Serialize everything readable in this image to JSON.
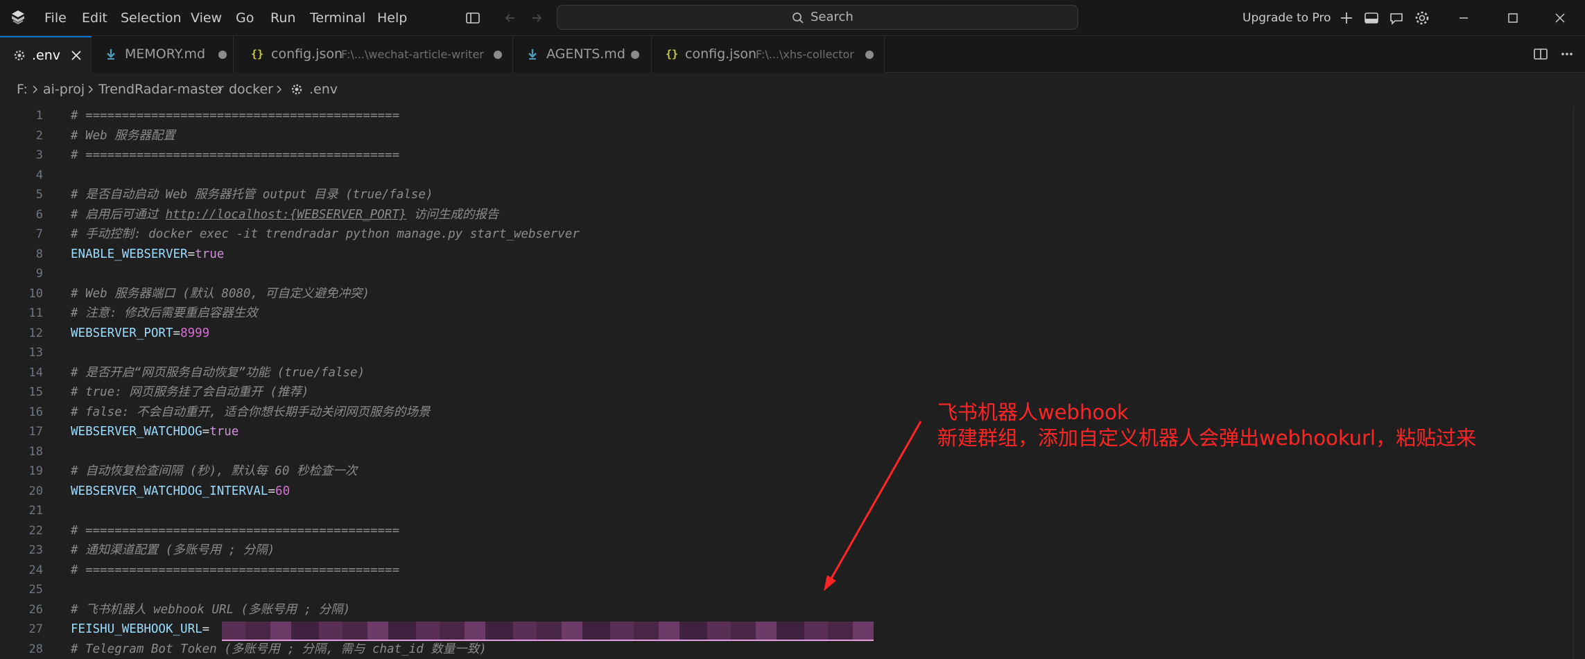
{
  "menu": [
    "File",
    "Edit",
    "Selection",
    "View",
    "Go",
    "Run",
    "Terminal",
    "Help"
  ],
  "search": {
    "label": "Search"
  },
  "titlebar": {
    "upgrade": "Upgrade to Pro"
  },
  "tabs": [
    {
      "label": ".env",
      "desc": "",
      "icon": "gear-icon",
      "state": "active"
    },
    {
      "label": "MEMORY.md",
      "desc": "",
      "icon": "markdown-icon",
      "state": "dirty"
    },
    {
      "label": "config.json",
      "desc": "F:\\...\\wechat-article-writer",
      "icon": "json-icon",
      "state": "dirty"
    },
    {
      "label": "AGENTS.md",
      "desc": "",
      "icon": "markdown-icon",
      "state": "dirty"
    },
    {
      "label": "config.json",
      "desc": "F:\\...\\xhs-collector",
      "icon": "json-icon",
      "state": "dirty"
    }
  ],
  "breadcrumb": [
    "F:",
    "ai-proj",
    "TrendRadar-master",
    "docker",
    ".env"
  ],
  "code": {
    "line_numbers": [
      "1",
      "2",
      "3",
      "4",
      "5",
      "6",
      "7",
      "8",
      "9",
      "10",
      "11",
      "12",
      "13",
      "14",
      "15",
      "16",
      "17",
      "18",
      "19",
      "20",
      "21",
      "22",
      "23",
      "24",
      "25",
      "26",
      "27",
      "28"
    ],
    "l1": "# ===========================================",
    "l2": "# Web 服务器配置",
    "l3": "# ===========================================",
    "l5": "# 是否自动启动 Web 服务器托管 output 目录 (true/false)",
    "l6_pre": "# 启用后可通过 ",
    "l6_url": "http://localhost:{WEBSERVER_PORT}",
    "l6_post": " 访问生成的报告",
    "l7": "# 手动控制: docker exec -it trendradar python manage.py start_webserver",
    "l8_key": "ENABLE_WEBSERVER",
    "l8_val": "true",
    "l10": "# Web 服务器端口 (默认 8080, 可自定义避免冲突)",
    "l11": "# 注意: 修改后需要重启容器生效",
    "l12_key": "WEBSERVER_PORT",
    "l12_val": "8999",
    "l14": "# 是否开启“网页服务自动恢复”功能 (true/false)",
    "l15": "# true: 网页服务挂了会自动重开 (推荐)",
    "l16": "# false: 不会自动重开, 适合你想长期手动关闭网页服务的场景",
    "l17_key": "WEBSERVER_WATCHDOG",
    "l17_val": "true",
    "l19": "# 自动恢复检查间隔 (秒), 默认每 60 秒检查一次",
    "l20_key": "WEBSERVER_WATCHDOG_INTERVAL",
    "l20_val": "60",
    "l22": "# ===========================================",
    "l23": "# 通知渠道配置 (多账号用 ; 分隔)",
    "l24": "# ===========================================",
    "l26": "# 飞书机器人 webhook URL (多账号用 ; 分隔)",
    "l27_key": "FEISHU_WEBHOOK_URL",
    "l28": "# Telegram Bot Token (多账号用 ; 分隔, 需与 chat_id 数量一致)"
  },
  "annotation": {
    "title": "飞书机器人webhook",
    "body": "新建群组，添加自定义机器人会弹出webhookurl，粘贴过来",
    "color": "#ff2525"
  },
  "colors": {
    "background": "#1f1f1f",
    "accent": "#0078d4",
    "key": "#9cdcfe",
    "value": "#ce92d8",
    "comment": "#8b8b8b"
  }
}
